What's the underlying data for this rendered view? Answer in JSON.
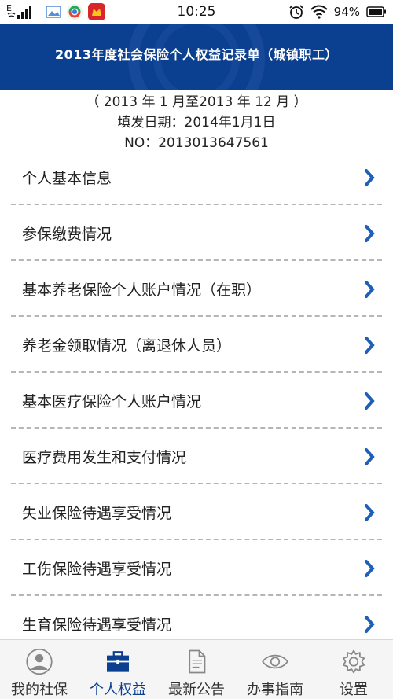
{
  "status_bar": {
    "time": "10:25",
    "battery": "94%",
    "network": "E"
  },
  "header": {
    "title": "2013年度社会保险个人权益记录单（城镇职工）"
  },
  "info": {
    "period": "（ 2013 年 1 月至2013 年 12 月 ）",
    "issue_date": "填发日期：2014年1月1日",
    "number": "NO：2013013647561"
  },
  "menu": {
    "items": [
      {
        "label": "个人基本信息"
      },
      {
        "label": "参保缴费情况"
      },
      {
        "label": "基本养老保险个人账户情况（在职）"
      },
      {
        "label": "养老金领取情况（离退休人员）"
      },
      {
        "label": "基本医疗保险个人账户情况"
      },
      {
        "label": "医疗费用发生和支付情况"
      },
      {
        "label": "失业保险待遇享受情况"
      },
      {
        "label": "工伤保险待遇享受情况"
      },
      {
        "label": "生育保险待遇享受情况"
      }
    ]
  },
  "bottom_nav": {
    "items": [
      {
        "label": "我的社保",
        "icon": "user-icon"
      },
      {
        "label": "个人权益",
        "icon": "briefcase-icon"
      },
      {
        "label": "最新公告",
        "icon": "document-icon"
      },
      {
        "label": "办事指南",
        "icon": "eye-icon"
      },
      {
        "label": "设置",
        "icon": "gear-icon"
      }
    ],
    "active_index": 1
  },
  "colors": {
    "primary": "#0b3f8f",
    "arrow": "#1f5fb8",
    "divider": "#b5b5b5"
  }
}
